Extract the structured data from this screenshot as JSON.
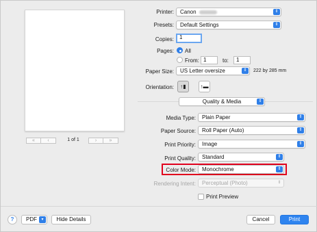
{
  "preview": {
    "page_count": "1 of 1",
    "first_icon": "«",
    "prev_icon": "‹",
    "next_icon": "›",
    "last_icon": "»"
  },
  "printer": {
    "label": "Printer:",
    "value": "Canon"
  },
  "presets": {
    "label": "Presets:",
    "value": "Default Settings"
  },
  "copies": {
    "label": "Copies:",
    "value": "1"
  },
  "pages": {
    "label": "Pages:",
    "all_label": "All",
    "from_label": "From:",
    "from_value": "1",
    "to_label": "to:",
    "to_value": "1",
    "selected": "All"
  },
  "paper_size": {
    "label": "Paper Size:",
    "value": "US Letter oversize",
    "dimensions": "222 by 285 mm"
  },
  "orientation": {
    "label": "Orientation:",
    "portrait_glyph": "↑▮",
    "landscape_glyph": "↑▬",
    "selected": "portrait"
  },
  "section": {
    "value": "Quality & Media"
  },
  "media_type": {
    "label": "Media Type:",
    "value": "Plain Paper"
  },
  "paper_source": {
    "label": "Paper Source:",
    "value": "Roll Paper (Auto)"
  },
  "print_priority": {
    "label": "Print Priority:",
    "value": "Image"
  },
  "print_quality": {
    "label": "Print Quality:",
    "value": "Standard"
  },
  "color_mode": {
    "label": "Color Mode:",
    "value": "Monochrome"
  },
  "rendering_intent": {
    "label": "Rendering Intent:",
    "value": "Perceptual (Photo)"
  },
  "print_preview": {
    "label": "Print Preview",
    "checked": false
  },
  "footer": {
    "help": "?",
    "pdf": "PDF",
    "hide_details": "Hide Details",
    "cancel": "Cancel",
    "print": "Print"
  },
  "colors": {
    "accent": "#2f7fe8",
    "highlight": "#e1001d",
    "primary_button": "#2f84ef"
  },
  "icons": {
    "popup": "updown-arrows-icon",
    "help": "help-icon"
  }
}
